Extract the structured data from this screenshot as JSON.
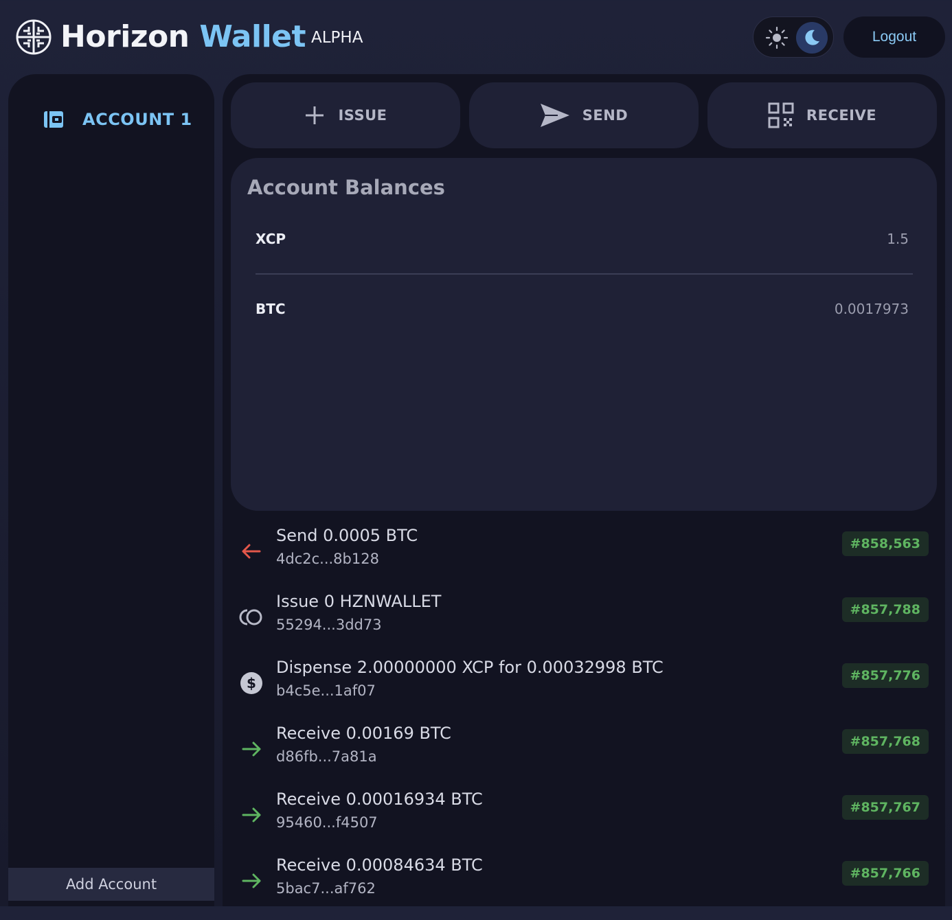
{
  "header": {
    "brand_first": "Horizon",
    "brand_second": "Wallet",
    "badge": "ALPHA",
    "logout_label": "Logout",
    "theme_icons": [
      "sun-icon",
      "moon-icon"
    ]
  },
  "sidebar": {
    "account_label": "ACCOUNT 1",
    "add_account_label": "Add Account"
  },
  "actions": {
    "issue_label": "ISSUE",
    "send_label": "SEND",
    "receive_label": "RECEIVE"
  },
  "balances": {
    "title": "Account Balances",
    "rows": [
      {
        "asset": "XCP",
        "amount": "1.5"
      },
      {
        "asset": "BTC",
        "amount": "0.0017973"
      }
    ]
  },
  "transactions": [
    {
      "title": "Send 0.0005 BTC",
      "hash": "4dc2c...8b128",
      "block": "#858,563",
      "icon": "arrow-left-icon"
    },
    {
      "title": "Issue 0 HZNWALLET",
      "hash": "55294...3dd73",
      "block": "#857,788",
      "icon": "coins-icon"
    },
    {
      "title": "Dispense 2.00000000 XCP for 0.00032998 BTC",
      "hash": "b4c5e...1af07",
      "block": "#857,776",
      "icon": "dollar-circle-icon"
    },
    {
      "title": "Receive 0.00169 BTC",
      "hash": "d86fb...7a81a",
      "block": "#857,768",
      "icon": "arrow-right-icon"
    },
    {
      "title": "Receive 0.00016934 BTC",
      "hash": "95460...f4507",
      "block": "#857,767",
      "icon": "arrow-right-icon"
    },
    {
      "title": "Receive 0.00084634 BTC",
      "hash": "5bac7...af762",
      "block": "#857,766",
      "icon": "arrow-right-icon"
    }
  ],
  "colors": {
    "accent": "#7cc4f4",
    "send": "#e3574a",
    "receive": "#5fb561",
    "block_badge_bg": "#1d2d26"
  }
}
